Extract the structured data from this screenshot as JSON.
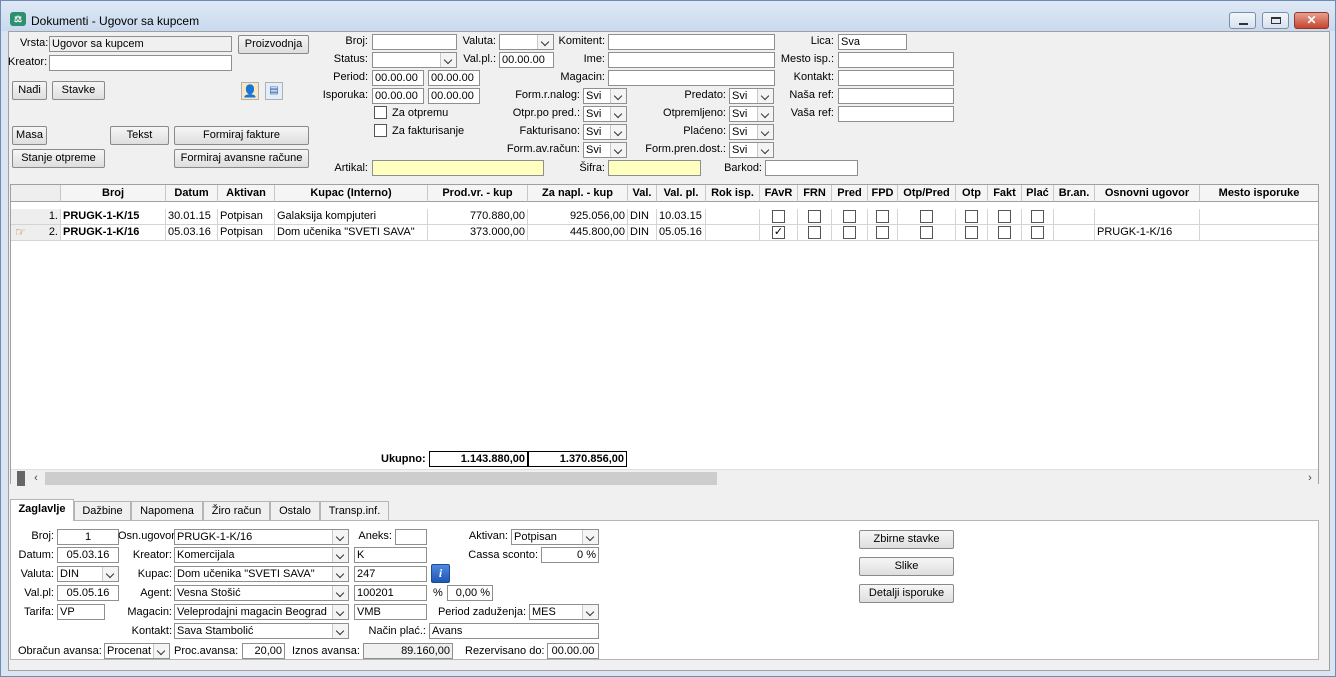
{
  "window": {
    "title": "Dokumenti - Ugovor sa kupcem"
  },
  "top": {
    "vrsta_label": "Vrsta:",
    "vrsta_value": "Ugovor sa kupcem",
    "kreator_label": "Kreator:",
    "kreator_value": "",
    "proizvodnja_btn": "Proizvodnja",
    "nadji_btn": "Nađi",
    "stavke_btn": "Stavke",
    "masa_btn": "Masa",
    "tekst_btn": "Tekst",
    "formiraj_fakture_btn": "Formiraj fakture",
    "stanje_otpreme_btn": "Stanje otpreme",
    "formiraj_avansne_btn": "Formiraj avansne račune",
    "broj_label": "Broj:",
    "broj_value": "",
    "valuta_label": "Valuta:",
    "valuta_value": "",
    "komitent_label": "Komitent:",
    "komitent_value": "",
    "lica_label": "Lica:",
    "lica_value": "Sva",
    "status_label": "Status:",
    "status_value": "",
    "valpl_label": "Val.pl.:",
    "valpl_value": "00.00.00",
    "ime_label": "Ime:",
    "ime_value": "",
    "mesto_isp_label": "Mesto isp.:",
    "mesto_isp_value": "",
    "period_label": "Period:",
    "period_from": "00.00.00",
    "period_to": "00.00.00",
    "magacin_label": "Magacin:",
    "magacin_value": "",
    "kontakt_label": "Kontakt:",
    "kontakt_value": "",
    "isporuka_label": "Isporuka:",
    "isporuka_from": "00.00.00",
    "isporuka_to": "00.00.00",
    "form_r_nalog_label": "Form.r.nalog:",
    "form_r_nalog_value": "Svi",
    "predato_label": "Predato:",
    "predato_value": "Svi",
    "nasa_ref_label": "Naša ref:",
    "nasa_ref_value": "",
    "za_otpremu": "Za otpremu",
    "otpr_po_pred_label": "Otpr.po pred.:",
    "otpr_po_pred_value": "Svi",
    "otpremljeno_label": "Otpremljeno:",
    "otpremljeno_value": "Svi",
    "vasa_ref_label": "Vaša ref:",
    "vasa_ref_value": "",
    "za_fakturisanje": "Za fakturisanje",
    "fakturisano_label": "Fakturisano:",
    "fakturisano_value": "Svi",
    "placeno_label": "Plaćeno:",
    "placeno_value": "Svi",
    "form_av_racun_label": "Form.av.račun:",
    "form_av_racun_value": "Svi",
    "form_pren_dost_label": "Form.pren.dost.:",
    "form_pren_dost_value": "Svi",
    "artikal_label": "Artikal:",
    "artikal_value": "",
    "sifra_label": "Šifra:",
    "sifra_value": "",
    "barkod_label": "Barkod:",
    "barkod_value": ""
  },
  "grid": {
    "columns": [
      "Broj",
      "Datum",
      "Aktivan",
      "Kupac (Interno)",
      "Prod.vr. - kup",
      "Za napl. - kup",
      "Val.",
      "Val. pl.",
      "Rok isp.",
      "FAvR",
      "FRN",
      "Pred",
      "FPD",
      "Otp/Pred",
      "Otp",
      "Fakt",
      "Plać",
      "Br.an.",
      "Osnovni ugovor",
      "Mesto isporuke"
    ],
    "rows": [
      {
        "num": "1.",
        "broj": "PRUGK-1-K/15",
        "datum": "30.01.15",
        "aktivan": "Potpisan",
        "kupac": "Galaksija kompjuteri",
        "prod": "770.880,00",
        "napl": "925.056,00",
        "val": "DIN",
        "valpl": "10.03.15",
        "rok": "",
        "favr": false,
        "osnovni": ""
      },
      {
        "num": "2.",
        "broj": "PRUGK-1-K/16",
        "datum": "05.03.16",
        "aktivan": "Potpisan",
        "kupac": "Dom učenika \"SVETI SAVA\"",
        "prod": "373.000,00",
        "napl": "445.800,00",
        "val": "DIN",
        "valpl": "05.05.16",
        "rok": "",
        "favr": true,
        "osnovni": "PRUGK-1-K/16"
      }
    ],
    "total_label": "Ukupno:",
    "total_prod": "1.143.880,00",
    "total_napl": "1.370.856,00"
  },
  "tabs": [
    "Zaglavlje",
    "Dažbine",
    "Napomena",
    "Žiro račun",
    "Ostalo",
    "Transp.inf."
  ],
  "detail": {
    "broj_label": "Broj:",
    "broj_value": "1",
    "osn_ugovor_label": "Osn.ugovor:",
    "osn_ugovor_value": "PRUGK-1-K/16",
    "aneks_label": "Aneks:",
    "aneks_value": "",
    "aktivan_label": "Aktivan:",
    "aktivan_value": "Potpisan",
    "datum_label": "Datum:",
    "datum_value": "05.03.16",
    "kreator_label": "Kreator:",
    "kreator_value": "Komercijala",
    "kreator_code": "K",
    "cassa_label": "Cassa sconto:",
    "cassa_value": "0 %",
    "valuta_label": "Valuta:",
    "valuta_value": "DIN",
    "kupac_label": "Kupac:",
    "kupac_value": "Dom učenika \"SVETI SAVA\"",
    "kupac_code": "247",
    "valpl_label": "Val.pl:",
    "valpl_value": "05.05.16",
    "agent_label": "Agent:",
    "agent_value": "Vesna Stošić",
    "agent_code": "100201",
    "pct_label": "%",
    "pct_value": "0,00 %",
    "tarifa_label": "Tarifa:",
    "tarifa_value": "VP",
    "magacin_label": "Magacin:",
    "magacin_value": "Veleprodajni magacin Beograd",
    "magacin_code": "VMB",
    "period_zad_label": "Period zaduženja:",
    "period_zad_value": "MES",
    "kontakt_label": "Kontakt:",
    "kontakt_value": "Sava Stambolić",
    "nacin_plac_label": "Način plać.:",
    "nacin_plac_value": "Avans",
    "obracun_label": "Obračun avansa:",
    "obracun_value": "Procenat",
    "proc_label": "Proc.avansa:",
    "proc_value": "20,00",
    "iznos_label": "Iznos avansa:",
    "iznos_value": "89.160,00",
    "rez_label": "Rezervisano do:",
    "rez_value": "00.00.00",
    "zbirne_btn": "Zbirne stavke",
    "slike_btn": "Slike",
    "detalji_btn": "Detalji isporuke"
  }
}
